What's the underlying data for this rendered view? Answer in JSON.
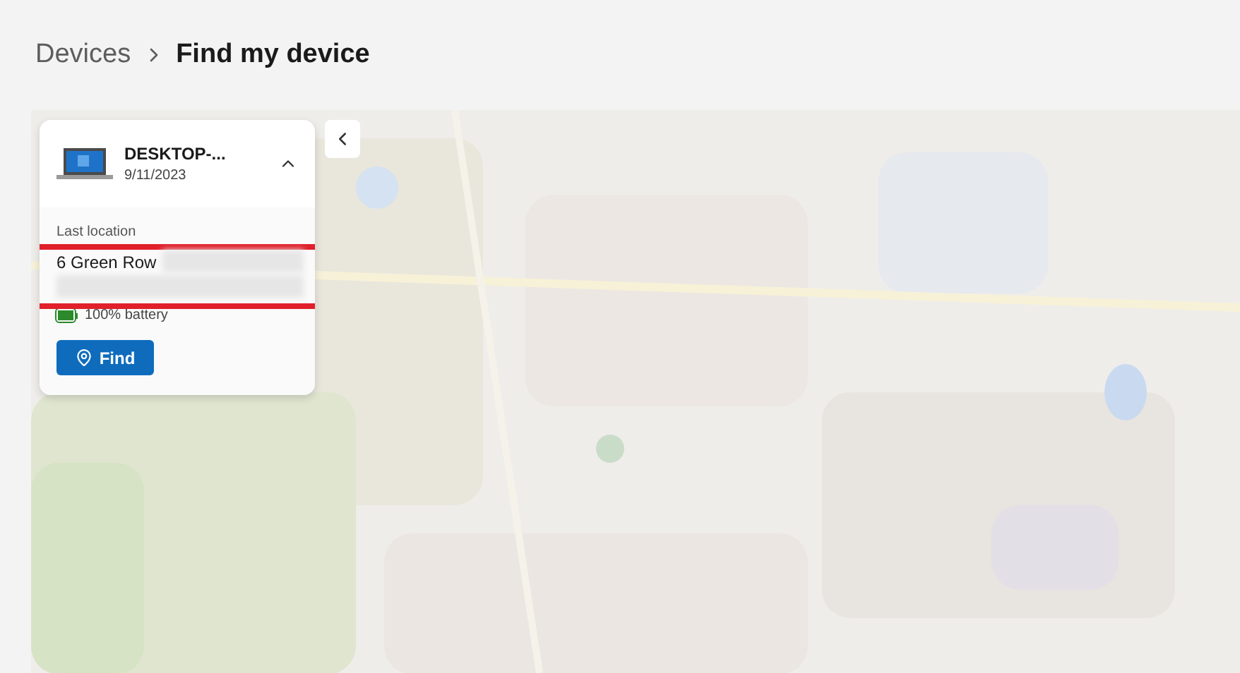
{
  "breadcrumb": [
    {
      "label": "Devices"
    },
    {
      "label": "Find my device"
    }
  ],
  "device": {
    "name": "DESKTOP-...",
    "date": "9/11/2023",
    "expanded": true,
    "location_label": "Last location",
    "address": "6 Green Row",
    "battery": {
      "text": "100% battery",
      "level": 1
    },
    "find_button": "Find"
  }
}
